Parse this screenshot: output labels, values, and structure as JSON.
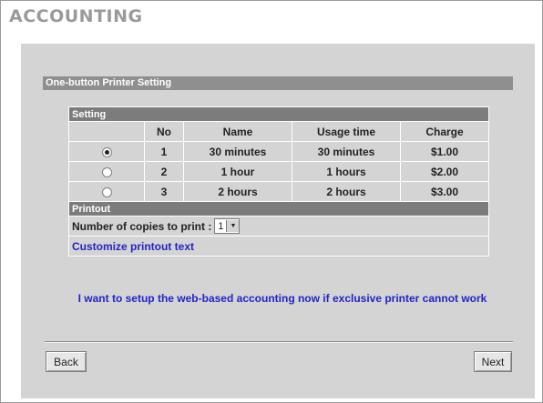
{
  "page": {
    "title": "ACCOUNTING"
  },
  "section": {
    "title": "One-button Printer Setting"
  },
  "setting_table": {
    "header": "Setting",
    "columns": [
      "No",
      "Name",
      "Usage time",
      "Charge"
    ],
    "rows": [
      {
        "selected": true,
        "no": "1",
        "name": "30 minutes",
        "usage": "30 minutes",
        "charge": "$1.00"
      },
      {
        "selected": false,
        "no": "2",
        "name": "1 hour",
        "usage": "1 hours",
        "charge": "$2.00"
      },
      {
        "selected": false,
        "no": "3",
        "name": "2 hours",
        "usage": "2 hours",
        "charge": "$3.00"
      }
    ]
  },
  "printout": {
    "header": "Printout",
    "copies_label": "Number of copies to print :",
    "copies_value": "1",
    "customize_link": "Customize printout text"
  },
  "web_accounting_link": "I want to setup the web-based accounting now if exclusive printer cannot work",
  "buttons": {
    "back": "Back",
    "next": "Next"
  }
}
